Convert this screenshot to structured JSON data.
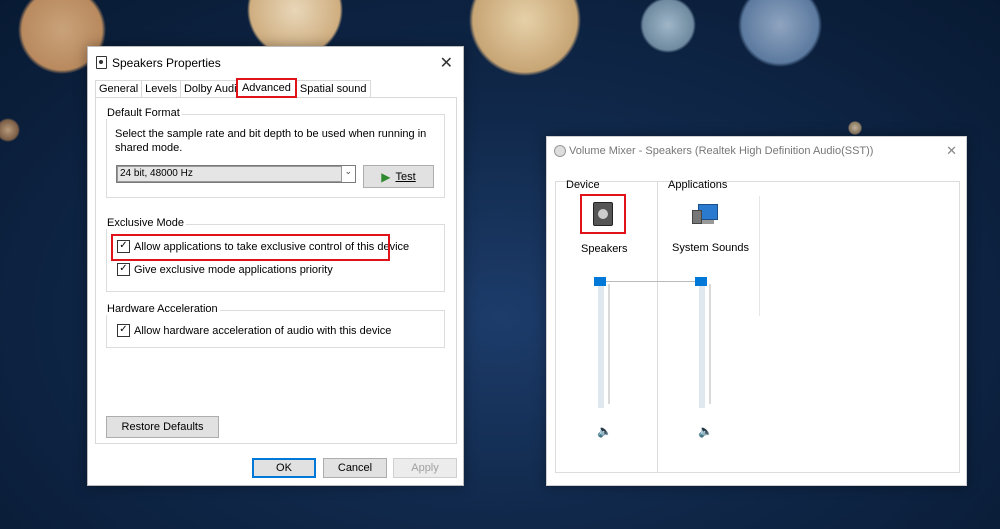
{
  "speakers_window": {
    "title": "Speakers Properties",
    "tabs": [
      "General",
      "Levels",
      "Dolby Audio",
      "Advanced",
      "Spatial sound"
    ],
    "active_tab": "Advanced",
    "default_format": {
      "group_title": "Default Format",
      "description": "Select the sample rate and bit depth to be used when running in shared mode.",
      "selected_format": "24 bit, 48000 Hz",
      "test_button": "Test"
    },
    "exclusive_mode": {
      "group_title": "Exclusive Mode",
      "allow_exclusive": {
        "label": "Allow applications to take exclusive control of this device",
        "checked": true
      },
      "give_priority": {
        "label": "Give exclusive mode applications priority",
        "checked": true
      }
    },
    "hardware_acceleration": {
      "group_title": "Hardware Acceleration",
      "allow_hw": {
        "label": "Allow hardware acceleration of audio with this device",
        "checked": true
      }
    },
    "restore_defaults": "Restore Defaults",
    "buttons": {
      "ok": "OK",
      "cancel": "Cancel",
      "apply": "Apply"
    },
    "highlight_color": "#e0121a"
  },
  "volume_mixer": {
    "title": "Volume Mixer - Speakers (Realtek High Definition Audio(SST))",
    "device_header": "Device",
    "applications_header": "Applications",
    "channels": [
      {
        "name": "Speakers",
        "icon": "speaker-device-icon",
        "volume": 1.0
      },
      {
        "name": "System Sounds",
        "icon": "system-sounds-icon",
        "volume": 1.0
      }
    ],
    "accent": "#0078d7"
  }
}
